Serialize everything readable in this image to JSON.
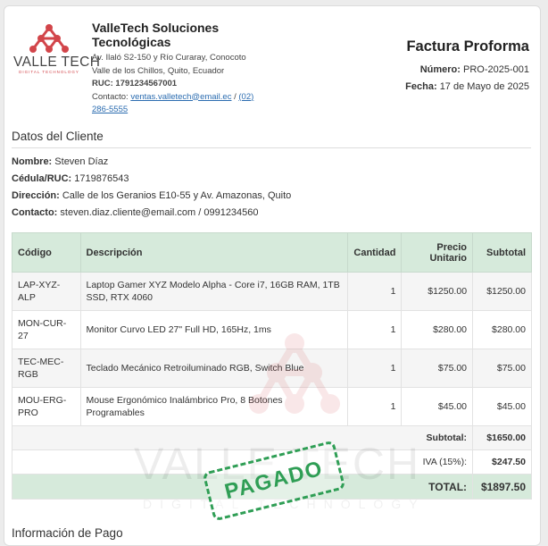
{
  "company": {
    "logo_text": "VALLE TECH",
    "logo_subtitle": "DIGITAL TECHNOLOGY",
    "name": "ValleTech Soluciones Tecnológicas",
    "address_line1": "Av. Ilaló S2-150 y Río Curaray, Conocoto",
    "address_line2": "Valle de los Chillos, Quito, Ecuador",
    "ruc_label": "RUC:",
    "ruc": "1791234567001",
    "contact_label": "Contacto:",
    "email": "ventas.valletech@email.ec",
    "separator": "/",
    "phone": "(02) 286-5555"
  },
  "invoice": {
    "title": "Factura Proforma",
    "number_label": "Número:",
    "number": "PRO-2025-001",
    "date_label": "Fecha:",
    "date": "17 de Mayo de 2025"
  },
  "customer": {
    "section_title": "Datos del Cliente",
    "name_label": "Nombre:",
    "name": "Steven Díaz",
    "id_label": "Cédula/RUC:",
    "id": "1719876543",
    "address_label": "Dirección:",
    "address": "Calle de los Geranios E10-55 y Av. Amazonas, Quito",
    "contact_label": "Contacto:",
    "contact": "steven.diaz.cliente@email.com / 0991234560"
  },
  "table": {
    "headers": [
      "Código",
      "Descripción",
      "Cantidad",
      "Precio Unitario",
      "Subtotal"
    ],
    "rows": [
      {
        "code": "LAP-XYZ-ALP",
        "description": "Laptop Gamer XYZ Modelo Alpha - Core i7, 16GB RAM, 1TB SSD, RTX 4060",
        "qty": "1",
        "unit_price": "$1250.00",
        "subtotal": "$1250.00"
      },
      {
        "code": "MON-CUR-27",
        "description": "Monitor Curvo LED 27\" Full HD, 165Hz, 1ms",
        "qty": "1",
        "unit_price": "$280.00",
        "subtotal": "$280.00"
      },
      {
        "code": "TEC-MEC-RGB",
        "description": "Teclado Mecánico Retroiluminado RGB, Switch Blue",
        "qty": "1",
        "unit_price": "$75.00",
        "subtotal": "$75.00"
      },
      {
        "code": "MOU-ERG-PRO",
        "description": "Mouse Ergonómico Inalámbrico Pro, 8 Botones Programables",
        "qty": "1",
        "unit_price": "$45.00",
        "subtotal": "$45.00"
      }
    ],
    "subtotal_label": "Subtotal:",
    "subtotal": "$1650.00",
    "tax_label": "IVA (15%):",
    "tax": "$247.50",
    "total_label": "TOTAL:",
    "total": "$1897.50"
  },
  "stamp": "PAGADO",
  "payment": {
    "section_title": "Información de Pago"
  },
  "colors": {
    "header_green": "#d6eadb",
    "stamp_green": "#2f9e55",
    "brand_red": "#d2454a",
    "link_blue": "#2b6cb0"
  }
}
